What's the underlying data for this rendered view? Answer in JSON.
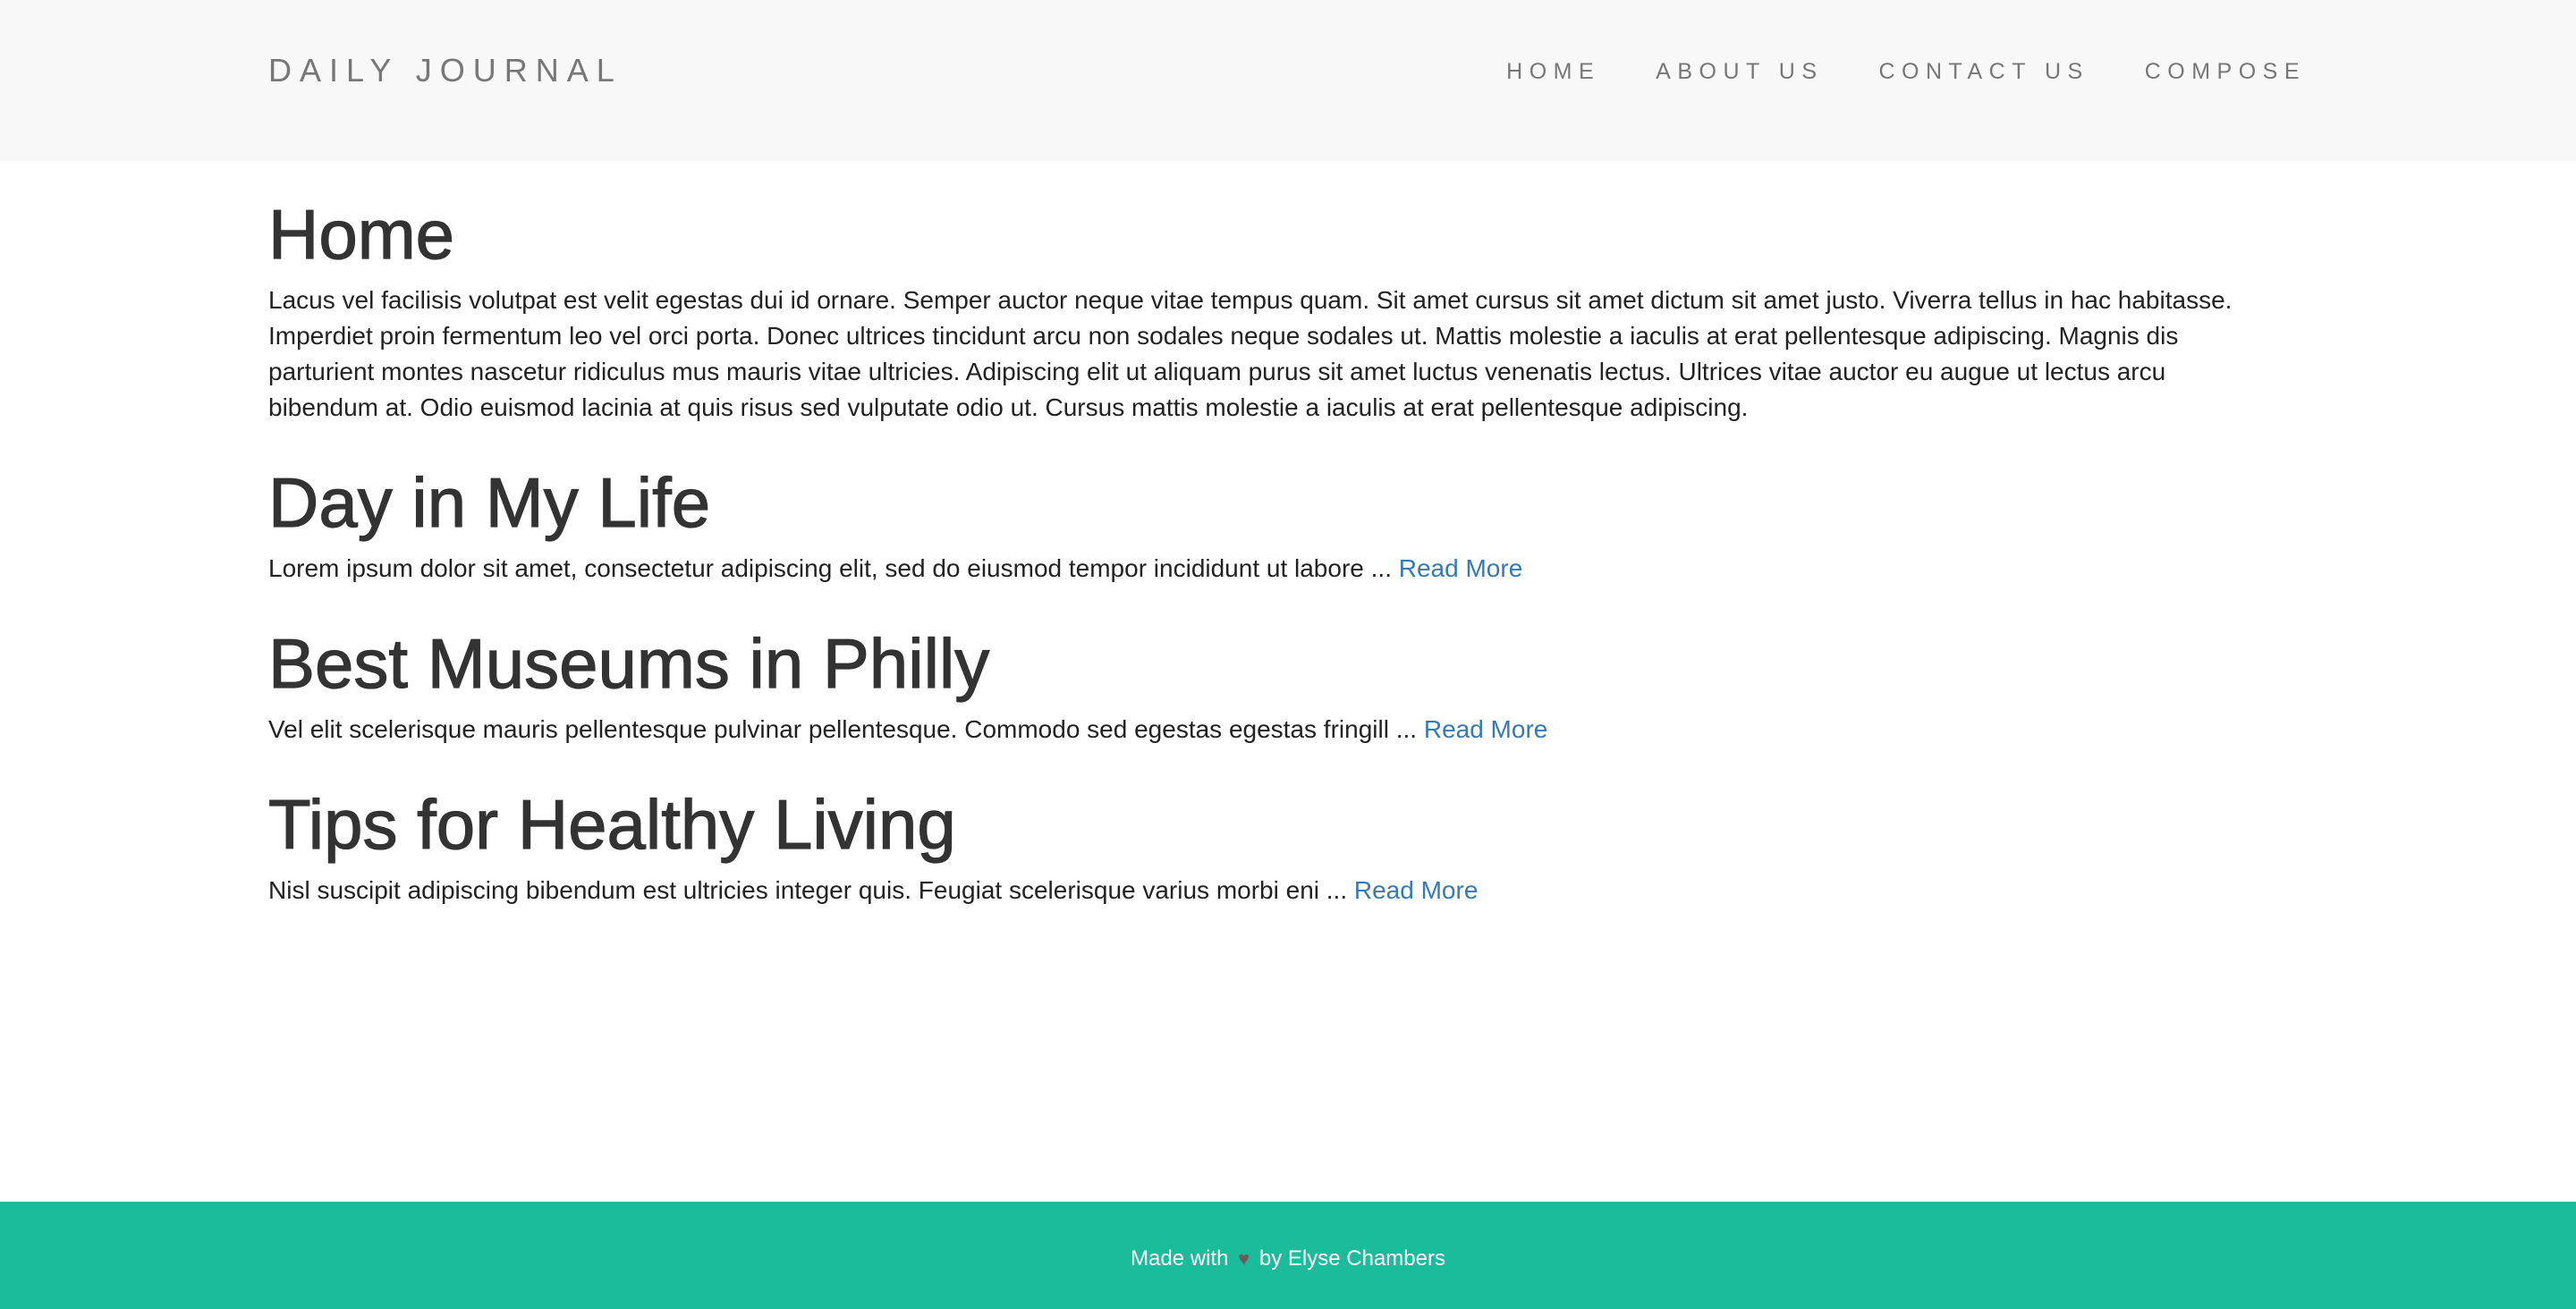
{
  "navbar": {
    "brand": "DAILY JOURNAL",
    "links": [
      {
        "label": "HOME"
      },
      {
        "label": "ABOUT US"
      },
      {
        "label": "CONTACT US"
      },
      {
        "label": "COMPOSE"
      }
    ]
  },
  "home": {
    "title": "Home",
    "text": "Lacus vel facilisis volutpat est velit egestas dui id ornare. Semper auctor neque vitae tempus quam. Sit amet cursus sit amet dictum sit amet justo. Viverra tellus in hac habitasse. Imperdiet proin fermentum leo vel orci porta. Donec ultrices tincidunt arcu non sodales neque sodales ut. Mattis molestie a iaculis at erat pellentesque adipiscing. Magnis dis parturient montes nascetur ridiculus mus mauris vitae ultricies. Adipiscing elit ut aliquam purus sit amet luctus venenatis lectus. Ultrices vitae auctor eu augue ut lectus arcu bibendum at. Odio euismod lacinia at quis risus sed vulputate odio ut. Cursus mattis molestie a iaculis at erat pellentesque adipiscing."
  },
  "posts": [
    {
      "title": "Day in My Life",
      "excerpt": "Lorem ipsum dolor sit amet, consectetur adipiscing elit, sed do eiusmod tempor incididunt ut labore ...",
      "read_more": "Read More"
    },
    {
      "title": "Best Museums in Philly",
      "excerpt": "Vel elit scelerisque mauris pellentesque pulvinar pellentesque. Commodo sed egestas egestas fringill ...",
      "read_more": "Read More"
    },
    {
      "title": "Tips for Healthy Living",
      "excerpt": "Nisl suscipit adipiscing bibendum est ultricies integer quis. Feugiat scelerisque varius morbi eni ...",
      "read_more": "Read More"
    }
  ],
  "footer": {
    "prefix": "Made with",
    "icon": "heart-icon",
    "suffix": "by Elyse Chambers"
  },
  "colors": {
    "navbar_bg": "#f8f8f8",
    "footer_bg": "#1abc9c",
    "link": "#337ab7",
    "heading": "#333333",
    "nav_text": "#777777"
  }
}
